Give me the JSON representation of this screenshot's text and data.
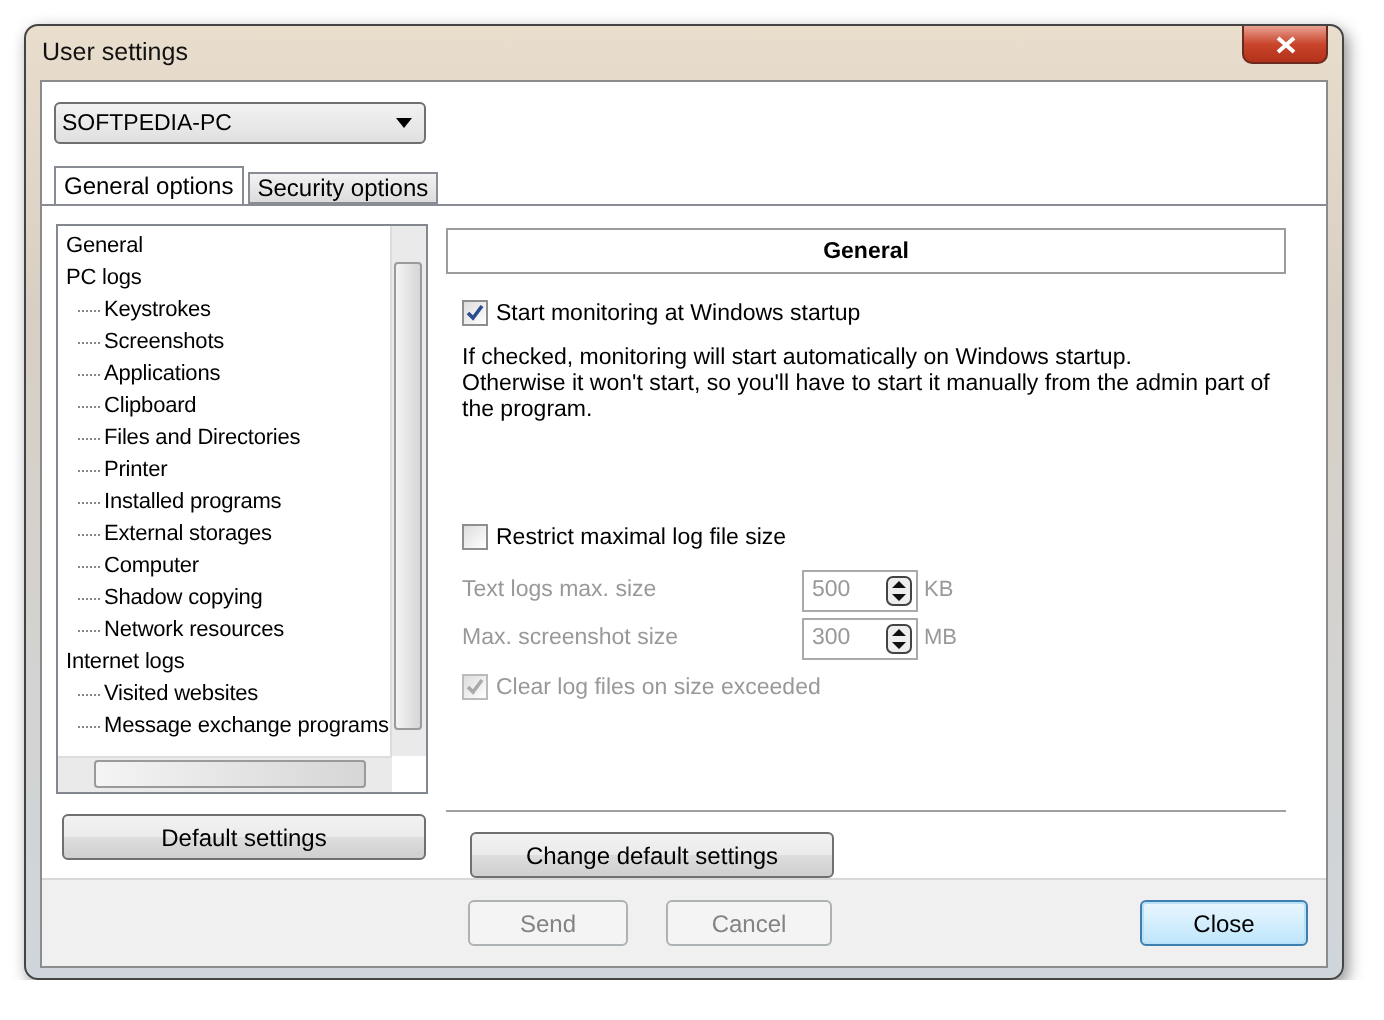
{
  "window": {
    "title": "User settings"
  },
  "computer_select": {
    "value": "SOFTPEDIA-PC"
  },
  "tabs": [
    {
      "label": "General options",
      "selected": true
    },
    {
      "label": "Security options",
      "selected": false
    }
  ],
  "tree": [
    {
      "label": "General"
    },
    {
      "label": "PC logs",
      "children": [
        {
          "label": "Keystrokes"
        },
        {
          "label": "Screenshots"
        },
        {
          "label": "Applications"
        },
        {
          "label": "Clipboard"
        },
        {
          "label": "Files and Directories"
        },
        {
          "label": "Printer"
        },
        {
          "label": "Installed programs"
        },
        {
          "label": "External storages"
        },
        {
          "label": "Computer"
        },
        {
          "label": "Shadow copying"
        },
        {
          "label": "Network resources"
        }
      ]
    },
    {
      "label": "Internet logs",
      "children": [
        {
          "label": "Visited websites"
        },
        {
          "label": "Message exchange programs"
        }
      ]
    }
  ],
  "section": {
    "title": "General",
    "start_monitoring": {
      "label": "Start monitoring at Windows startup",
      "checked": true,
      "disabled": false
    },
    "description": [
      "If checked, monitoring will start automatically on Windows startup.",
      "Otherwise it won't start, so you'll have to start it manually from the admin part of the program."
    ],
    "restrict_size": {
      "label": "Restrict maximal log file size",
      "checked": false,
      "disabled": false
    },
    "size_fields": [
      {
        "label": "Text logs max. size",
        "value": "500",
        "unit": "KB",
        "disabled": true
      },
      {
        "label": "Max. screenshot size",
        "value": "300",
        "unit": "MB",
        "disabled": true
      }
    ],
    "clear_logs": {
      "label": "Clear log files on size exceeded",
      "checked": true,
      "disabled": true
    }
  },
  "panel_buttons": [
    {
      "label": "Default settings"
    },
    {
      "label": "Change default settings"
    }
  ],
  "footer_buttons": [
    {
      "label": "Send",
      "disabled": true,
      "default": false
    },
    {
      "label": "Cancel",
      "disabled": true,
      "default": false
    },
    {
      "label": "Close",
      "disabled": false,
      "default": true
    }
  ]
}
